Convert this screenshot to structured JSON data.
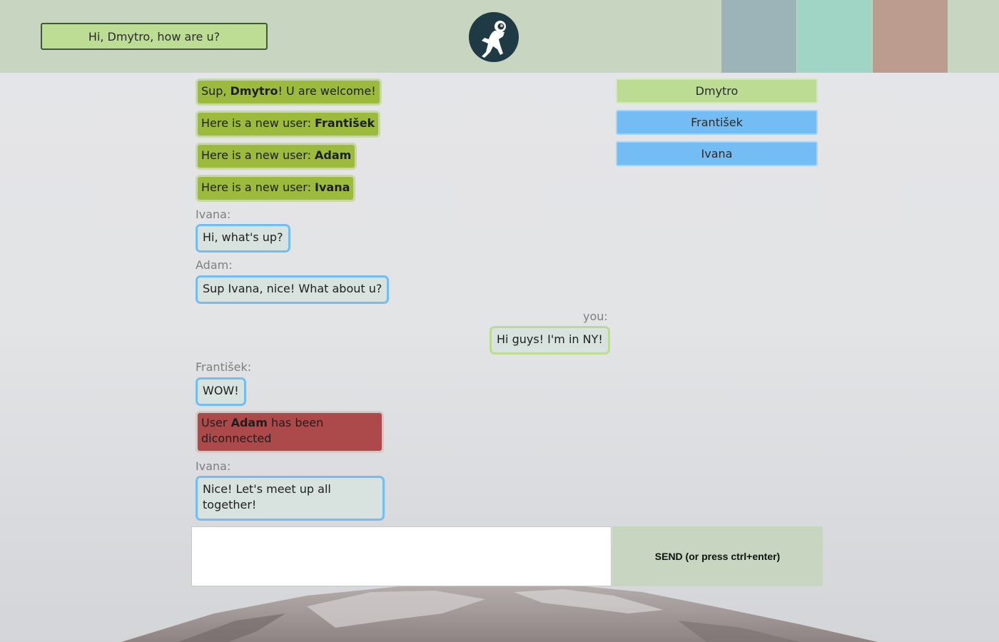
{
  "header": {
    "greeting": "Hi, Dmytro, how are u?",
    "logo_icon": "astronaut-icon",
    "swatch_colors": [
      "#9cb4b8",
      "#a0d5c5",
      "#bc9c8f"
    ]
  },
  "users": [
    {
      "name": "Dmytro",
      "color": "#bcdc93"
    },
    {
      "name": "František",
      "color": "#74bdf4"
    },
    {
      "name": "Ivana",
      "color": "#74bdf4"
    }
  ],
  "messages": {
    "sys1": {
      "prefix": "Sup, ",
      "name": "Dmytro",
      "suffix": "! U are welcome!"
    },
    "sys2": {
      "prefix": "Here is a new user: ",
      "name": "František"
    },
    "sys3": {
      "prefix": "Here is a new user: ",
      "name": "Adam"
    },
    "sys4": {
      "prefix": "Here is a new user: ",
      "name": "Ivana"
    },
    "m1": {
      "author": "Ivana:",
      "text": "Hi, what's up?"
    },
    "m2": {
      "author": "Adam:",
      "text": "Sup Ivana, nice! What about u?"
    },
    "m3": {
      "author": "you:",
      "text": "Hi guys! I'm in NY!"
    },
    "m4": {
      "author": "František:",
      "text": "WOW!"
    },
    "disc": {
      "prefix": "User ",
      "name": "Adam",
      "suffix": " has been diconnected"
    },
    "m5": {
      "author": "Ivana:",
      "text": "Nice! Let's meet up all together!"
    }
  },
  "composer": {
    "value": "",
    "send_label": "SEND (or press ctrl+enter)"
  },
  "colors": {
    "header_bg": "#c8d5c0",
    "system_msg": "#9cba3c",
    "user_border_blue": "#74bdf4",
    "own_border_green": "#bcdc93",
    "disconnect_msg": "#ac4a4b"
  }
}
